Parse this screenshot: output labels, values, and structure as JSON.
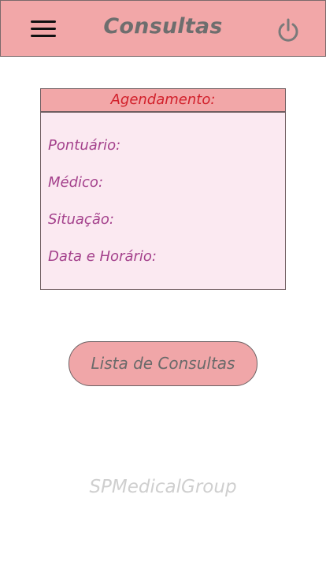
{
  "header": {
    "title": "Consultas",
    "menu_icon": "hamburger-menu-icon",
    "power_icon": "power-icon",
    "background_color": "#f2a7a8",
    "title_color": "#6e6e6e"
  },
  "appointment_card": {
    "title": "Agendamento:",
    "title_color": "#d2202b",
    "fields": [
      {
        "label": "Pontuário:"
      },
      {
        "label": "Médico:"
      },
      {
        "label": "Situação:"
      },
      {
        "label": "Data e Horário:"
      }
    ],
    "field_color": "#a4418c",
    "background_color": "#fbe9f1"
  },
  "actions": {
    "list_button_label": "Lista de Consultas"
  },
  "footer": {
    "brand": "SPMedicalGroup"
  }
}
